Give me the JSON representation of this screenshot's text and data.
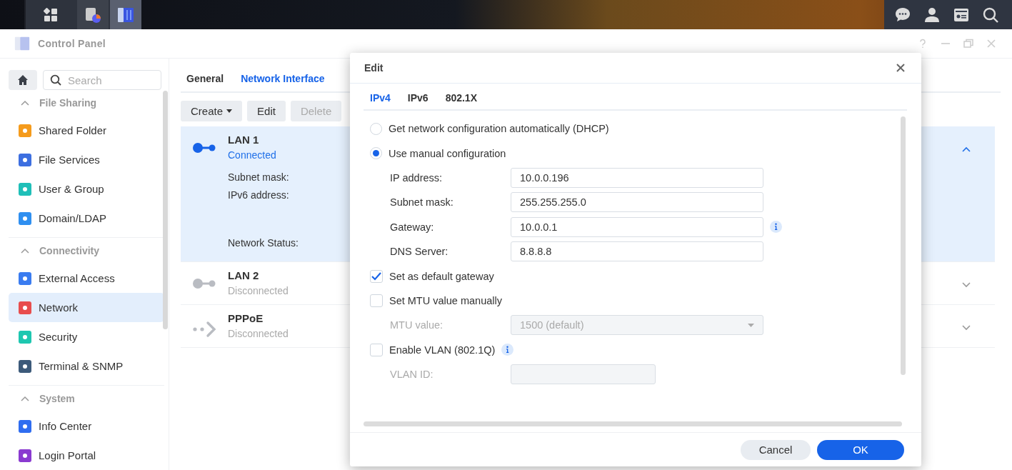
{
  "taskbar": {
    "left": [
      {
        "selected": false
      },
      {
        "selected": false
      },
      {
        "selected": true
      }
    ]
  },
  "window": {
    "title": "Control Panel"
  },
  "sidebar": {
    "search": {
      "placeholder": "Search"
    },
    "sections": [
      {
        "title": "File Sharing",
        "expanded": true,
        "items": [
          {
            "label": "Shared Folder",
            "selected": false
          },
          {
            "label": "File Services",
            "selected": false
          },
          {
            "label": "User & Group",
            "selected": false
          },
          {
            "label": "Domain/LDAP",
            "selected": false
          }
        ]
      },
      {
        "title": "Connectivity",
        "expanded": true,
        "items": [
          {
            "label": "External Access",
            "selected": false
          },
          {
            "label": "Network",
            "selected": true
          },
          {
            "label": "Security",
            "selected": false
          },
          {
            "label": "Terminal & SNMP",
            "selected": false
          }
        ]
      },
      {
        "title": "System",
        "expanded": true,
        "items": [
          {
            "label": "Info Center",
            "selected": false
          },
          {
            "label": "Login Portal",
            "selected": false
          }
        ]
      }
    ]
  },
  "tabs": [
    {
      "label": "General",
      "selected": false
    },
    {
      "label": "Network Interface",
      "selected": true
    }
  ],
  "toolbar": [
    {
      "label": "Create",
      "kind": "menu",
      "disabled": false
    },
    {
      "label": "Edit",
      "kind": "plain",
      "disabled": false
    },
    {
      "label": "Delete",
      "kind": "plain",
      "disabled": true
    }
  ],
  "interfaces": [
    {
      "name": "LAN 1",
      "kind": "lan",
      "status": "Connected",
      "connected": true,
      "selected": true,
      "expanded": true,
      "details": [
        "Subnet mask:",
        "IPv6 address:",
        "Network Status:"
      ]
    },
    {
      "name": "LAN 2",
      "kind": "lan",
      "status": "Disconnected",
      "connected": false,
      "selected": false,
      "expanded": false
    },
    {
      "name": "PPPoE",
      "kind": "pppoe",
      "status": "Disconnected",
      "connected": false,
      "selected": false,
      "expanded": false
    }
  ],
  "dialog": {
    "title": "Edit",
    "tabs": [
      {
        "label": "IPv4",
        "selected": true
      },
      {
        "label": "IPv6",
        "selected": false
      },
      {
        "label": "802.1X",
        "selected": false
      }
    ],
    "rows": [
      {
        "kind": "radio",
        "label": "Get network configuration automatically (DHCP)",
        "selected": false
      },
      {
        "kind": "radio",
        "label": "Use manual configuration",
        "selected": true
      },
      {
        "kind": "field",
        "label": "IP address:",
        "value": "10.0.0.196",
        "disabled": false,
        "info": false,
        "narrow": false
      },
      {
        "kind": "field",
        "label": "Subnet mask:",
        "value": "255.255.255.0",
        "disabled": false,
        "info": false,
        "narrow": false
      },
      {
        "kind": "field",
        "label": "Gateway:",
        "value": "10.0.0.1",
        "disabled": false,
        "info": true,
        "narrow": false
      },
      {
        "kind": "field",
        "label": "DNS Server:",
        "value": "8.8.8.8",
        "disabled": false,
        "info": false,
        "narrow": false
      },
      {
        "kind": "checkbox",
        "label": "Set as default gateway",
        "checked": true,
        "info": false
      },
      {
        "kind": "checkbox",
        "label": "Set MTU value manually",
        "checked": false,
        "info": false
      },
      {
        "kind": "select",
        "label": "MTU value:",
        "value": "1500 (default)",
        "disabled": true
      },
      {
        "kind": "checkbox",
        "label": "Enable VLAN (802.1Q)",
        "checked": false,
        "info": true
      },
      {
        "kind": "field",
        "label": "VLAN ID:",
        "disabled": true,
        "info": false,
        "narrow": true
      }
    ],
    "buttons": [
      {
        "label": "Cancel",
        "kind": "secondary"
      },
      {
        "label": "OK",
        "kind": "primary"
      }
    ]
  }
}
